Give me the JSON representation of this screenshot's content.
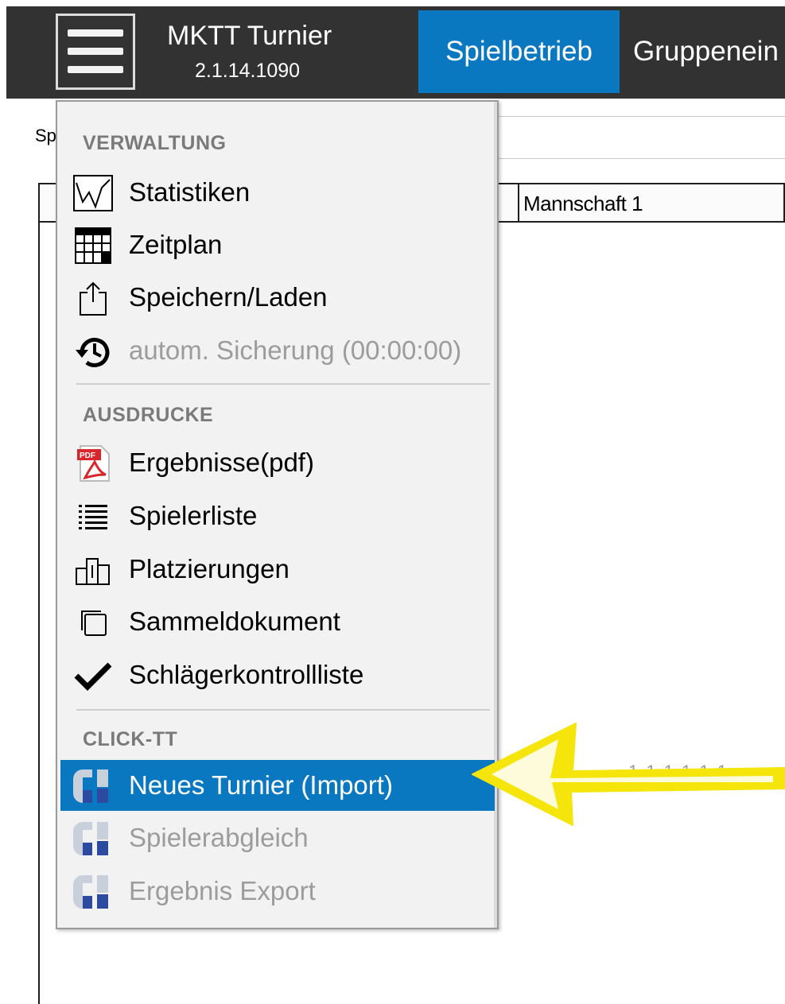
{
  "header": {
    "app_title": "MKTT Turnier",
    "app_version": "2.1.14.1090",
    "tabs": [
      {
        "label": "Spielbetrieb",
        "active": true
      },
      {
        "label": "Gruppenein"
      }
    ],
    "accent_color": "#0a78c0",
    "bar_color": "#323232"
  },
  "background": {
    "label_fragment": "Sp",
    "grid_columns": [
      "Mannschaft 1"
    ],
    "faint_text": "1 1 1 1 1 1"
  },
  "menu": {
    "sections": [
      {
        "title": "VERWALTUNG",
        "items": [
          {
            "label": "Statistiken",
            "icon": "statistics-icon"
          },
          {
            "label": "Zeitplan",
            "icon": "schedule-grid-icon"
          },
          {
            "label": "Speichern/Laden",
            "icon": "share-upload-icon"
          },
          {
            "label": "autom. Sicherung (00:00:00)",
            "icon": "history-clock-icon",
            "disabled": true
          }
        ]
      },
      {
        "title": "AUSDRUCKE",
        "items": [
          {
            "label": "Ergebnisse(pdf)",
            "icon": "pdf-icon"
          },
          {
            "label": "Spielerliste",
            "icon": "list-icon"
          },
          {
            "label": "Platzierungen",
            "icon": "podium-icon"
          },
          {
            "label": "Sammeldokument",
            "icon": "document-stack-icon"
          },
          {
            "label": "Schlägerkontrollliste",
            "icon": "checkmark-icon"
          }
        ]
      },
      {
        "title": "CLICK-TT",
        "items": [
          {
            "label": "Neues Turnier (Import)",
            "icon": "click-tt-icon",
            "selected": true
          },
          {
            "label": "Spielerabgleich",
            "icon": "click-tt-icon",
            "disabled": true
          },
          {
            "label": "Ergebnis Export",
            "icon": "click-tt-icon",
            "disabled": true
          }
        ]
      }
    ]
  },
  "annotation": {
    "arrow_color": "#f5e50a",
    "points_to": "Neues Turnier (Import)"
  }
}
